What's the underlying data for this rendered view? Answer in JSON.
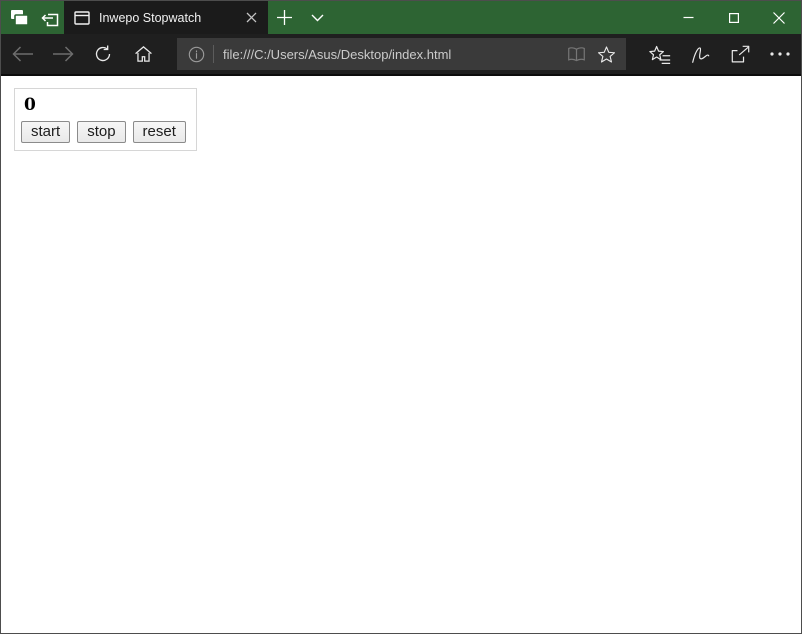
{
  "titlebar": {
    "tab": {
      "title": "Inwepo Stopwatch"
    }
  },
  "navbar": {
    "address": {
      "url": "file:///C:/Users/Asus/Desktop/index.html"
    }
  },
  "page": {
    "stopwatch": {
      "display": "0",
      "buttons": [
        {
          "label": "start"
        },
        {
          "label": "stop"
        },
        {
          "label": "reset"
        }
      ]
    }
  },
  "colors": {
    "titlebar_green": "#2d6433",
    "tab_background": "#1b1b1b",
    "navbar_background": "#1f1f1f",
    "addressbar_background": "#3a3a3a",
    "page_background": "#ffffff",
    "button_border": "#8b8b8b"
  }
}
